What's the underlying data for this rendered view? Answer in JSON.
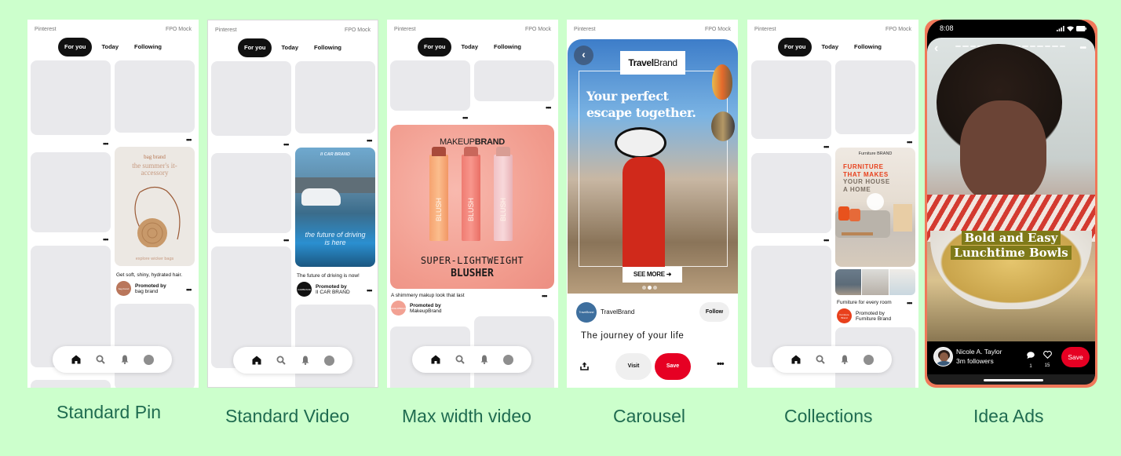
{
  "common": {
    "app_name": "Pinterest",
    "mock_label": "FPO Mock",
    "tabs": [
      "For you",
      "Today",
      "Following"
    ],
    "active_tab": "For you",
    "nav_icons": [
      "home-icon",
      "search-icon",
      "bell-icon",
      "profile-icon"
    ],
    "more_glyph": "•••"
  },
  "phones": [
    {
      "caption": "Standard Pin",
      "pin": {
        "brand": "bag brand",
        "headline": "the summer's it-accessory",
        "cta": "explore wicker bags",
        "description": "Get soft, shiny, hydrated hair.",
        "promoted_label": "Promoted by",
        "advertiser": "bag brand",
        "avatar_text": "bag brand",
        "avatar_color": "#b9765b"
      }
    },
    {
      "caption": "Standard Video",
      "pin": {
        "brand": "II CAR BRAND",
        "headline": "the future of driving is here",
        "description": "The future of driving is now!",
        "promoted_label": "Promoted by",
        "advertiser": "II CAR BRAND",
        "avatar_text": "CARBRAND",
        "avatar_color": "#111111"
      }
    },
    {
      "caption": "Max width video",
      "pin": {
        "brand_light": "MAKEUP",
        "brand_bold": "BRAND",
        "product_label": "BLUSH",
        "headline_1": "SUPER-LIGHTWEIGHT",
        "headline_2": "BLUSHER",
        "description": "A shimmery makup look that last",
        "promoted_label": "Promoted by",
        "advertiser": "MakeupBrand",
        "avatar_text": "MAKEUPBRAND",
        "avatar_color": "#f2a193"
      }
    },
    {
      "caption": "Carousel",
      "pin": {
        "brand_bold": "Travel",
        "brand_light": "Brand",
        "headline": "Your perfect escape together.",
        "cta": "SEE MORE",
        "carousel_pages": 3,
        "carousel_active": 2,
        "advertiser": "TravelBrand",
        "avatar_text": "TravelBrand",
        "avatar_color": "#3e6f9e",
        "follow_label": "Follow",
        "title": "The journey of your life",
        "visit_label": "Visit",
        "save_label": "Save",
        "save_color": "#e60023"
      }
    },
    {
      "caption": "Collections",
      "pin": {
        "brand": "Furniture BRAND",
        "headline_1": "FURNITURE",
        "headline_2": "THAT MAKES",
        "headline_3": "YOUR HOUSE",
        "headline_4": "A HOME",
        "description": "Furniture for every room",
        "promoted_label": "Promoted by",
        "advertiser": "Furniture Brand",
        "avatar_text": "Furniture Brand",
        "avatar_color": "#e8401c"
      }
    },
    {
      "caption": "Idea Ads",
      "pin": {
        "status_time": "8:08",
        "overlay_title_1": "Bold and Easy",
        "overlay_title_2": "Lunchtime Bowls",
        "creator_name": "Nicole A. Taylor",
        "creator_followers": "3m followers",
        "comment_count": "1",
        "like_count": "15",
        "save_label": "Save",
        "save_color": "#e60023",
        "frame_color": "#f0785a",
        "story_segments": 15
      }
    }
  ]
}
